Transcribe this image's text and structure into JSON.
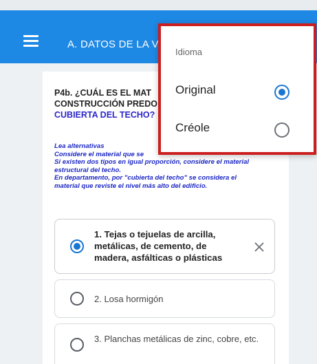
{
  "app_bar": {
    "title": "A. DATOS DE LA VI"
  },
  "question": {
    "prefix": "P4b. ¿CUÁL ES EL MAT",
    "line2": "CONSTRUCCIÓN PREDO",
    "highlight": "CUBIERTA DEL TECHO?"
  },
  "instructions": {
    "line1": "Lea alternativas",
    "line2": "Considere el material que se",
    "line3": "Si existen dos tipos en igual proporción, considere el material",
    "line4": "estructural del techo.",
    "line5": "En departamento, por \"cubierta del techo\" se considera el",
    "line6": "material que reviste el nivel más alto del edificio."
  },
  "options": [
    {
      "label": "1. Tejas o tejuelas de arcilla, metálicas, de cemento, de madera, asfálticas o plásticas",
      "selected": true
    },
    {
      "label": "2. Losa hormigón",
      "selected": false
    },
    {
      "label": "3. Planchas metálicas de zinc, cobre, etc.",
      "selected": false
    }
  ],
  "language_popup": {
    "title": "Idioma",
    "items": [
      {
        "label": "Original",
        "selected": true
      },
      {
        "label": "Créole",
        "selected": false
      }
    ]
  },
  "colors": {
    "app_bar": "#1e88e5",
    "accent": "#1976d2",
    "highlight_border": "#cc1e1e",
    "instruction_text": "#1c27c4"
  },
  "icons": {
    "menu": "hamburger-icon",
    "clear": "close-icon"
  }
}
